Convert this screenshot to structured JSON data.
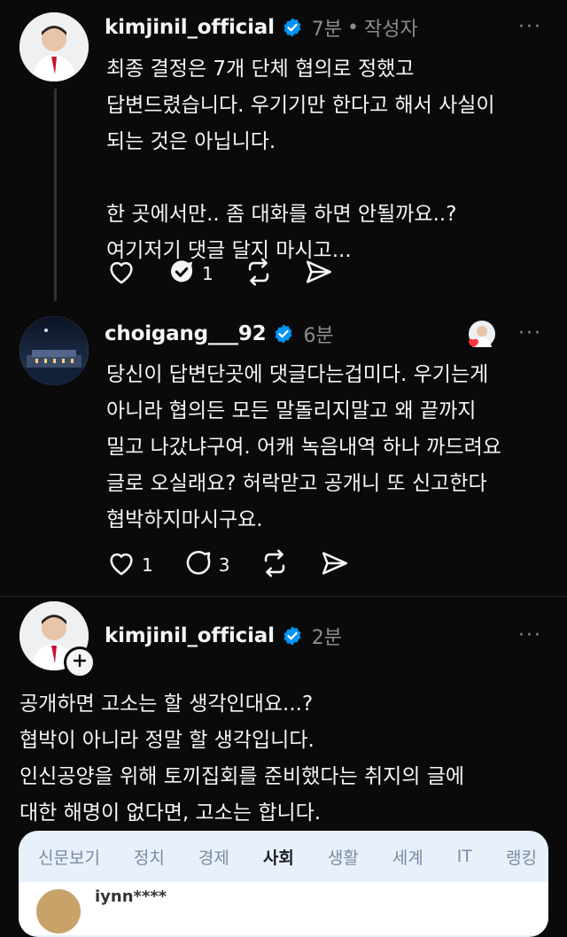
{
  "posts": [
    {
      "username": "kimjinil_official",
      "time": "7분",
      "tag": "작성자",
      "separator": "•",
      "body": "최종 결정은 7개 단체 협의로 정했고\n답변드렸습니다. 우기기만 한다고 해서 사실이\n되는 것은 아닙니다.\n\n한 곳에서만.. 좀 대화를 하면 안될까요..?\n여기저기 댓글 달지 마시고...",
      "likes": "",
      "replies": "1"
    },
    {
      "username": "choigang___92",
      "time": "6분",
      "body": "당신이 답변단곳에 댓글다는겁미다. 우기는게\n아니라 협의든 모든 말돌리지말고 왜 끝까지\n밀고 나갔냐구여. 어캐 녹음내역 하나 까드려요\n글로 오실래요? 허락맏고 공개니 또 신고한다\n협박하지마시구요.",
      "likes": "1",
      "replies": "3"
    },
    {
      "username": "kimjinil_official",
      "time": "2분",
      "body": "공개하면 고소는 할 생각인대요...?\n협박이 아니라 정말 할 생각입니다.\n인신공양을 위해 토끼집회를 준비했다는 취지의 글에\n대한 해명이 없다면, 고소는 합니다."
    }
  ],
  "more_label": "···",
  "news_card": {
    "tabs": [
      "신문보기",
      "정치",
      "경제",
      "사회",
      "생활",
      "세계",
      "IT",
      "랭킹"
    ],
    "active_tab": "사회",
    "sub_name": "iynn****"
  },
  "colors": {
    "background": "#0a0a0a",
    "verified": "#0095f6",
    "muted": "#8a8d91",
    "heart": "#ff3040"
  },
  "icons": [
    "heart-icon",
    "comment-icon",
    "repost-icon",
    "share-icon",
    "verified-badge-icon",
    "more-icon",
    "plus-icon"
  ]
}
